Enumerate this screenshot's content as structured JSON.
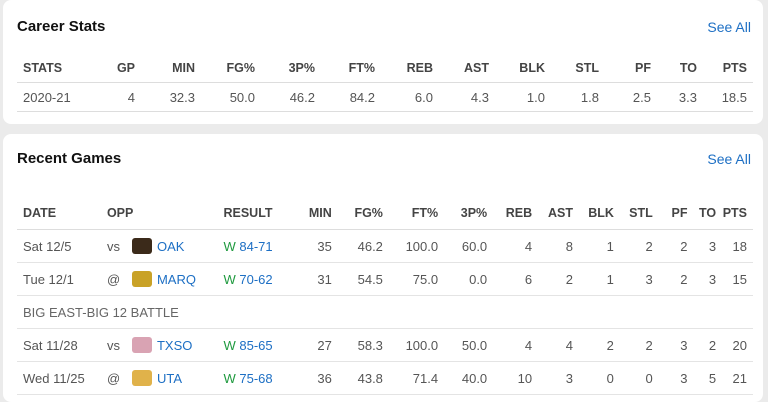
{
  "career": {
    "title": "Career Stats",
    "see_all": "See All",
    "headers": [
      "STATS",
      "GP",
      "MIN",
      "FG%",
      "3P%",
      "FT%",
      "REB",
      "AST",
      "BLK",
      "STL",
      "PF",
      "TO",
      "PTS"
    ],
    "row": [
      "2020-21",
      "4",
      "32.3",
      "50.0",
      "46.2",
      "84.2",
      "6.0",
      "4.3",
      "1.0",
      "1.8",
      "2.5",
      "3.3",
      "18.5"
    ]
  },
  "recent": {
    "title": "Recent Games",
    "see_all": "See All",
    "headers": [
      "DATE",
      "OPP",
      "RESULT",
      "MIN",
      "FG%",
      "FT%",
      "3P%",
      "REB",
      "AST",
      "BLK",
      "STL",
      "PF",
      "TO",
      "PTS"
    ],
    "games": [
      {
        "date": "Sat 12/5",
        "loc": "vs",
        "logo_color": "#3b2a1a",
        "opp": "OAK",
        "wl": "W",
        "score": "84-71",
        "stats": [
          "35",
          "46.2",
          "100.0",
          "60.0",
          "4",
          "8",
          "1",
          "2",
          "2",
          "3",
          "18"
        ]
      },
      {
        "date": "Tue 12/1",
        "loc": "@",
        "logo_color": "#c9a227",
        "opp": "MARQ",
        "wl": "W",
        "score": "70-62",
        "stats": [
          "31",
          "54.5",
          "75.0",
          "0.0",
          "6",
          "2",
          "1",
          "3",
          "2",
          "3",
          "15"
        ]
      }
    ],
    "section_label": "BIG EAST-BIG 12 BATTLE",
    "games2": [
      {
        "date": "Sat 11/28",
        "loc": "vs",
        "logo_color": "#d9a3b3",
        "opp": "TXSO",
        "wl": "W",
        "score": "85-65",
        "stats": [
          "27",
          "58.3",
          "100.0",
          "50.0",
          "4",
          "4",
          "2",
          "2",
          "3",
          "2",
          "20"
        ]
      },
      {
        "date": "Wed 11/25",
        "loc": "@",
        "logo_color": "#e0b24a",
        "opp": "UTA",
        "wl": "W",
        "score": "75-68",
        "stats": [
          "36",
          "43.8",
          "71.4",
          "40.0",
          "10",
          "3",
          "0",
          "0",
          "3",
          "5",
          "21"
        ]
      }
    ]
  }
}
